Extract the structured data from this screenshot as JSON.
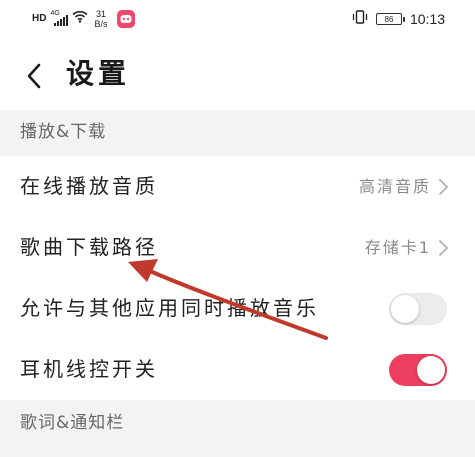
{
  "status_bar": {
    "hd": "HD",
    "network": "4G",
    "speed_value": "31",
    "speed_unit": "B/s",
    "battery": "86",
    "time": "10:13"
  },
  "header": {
    "title": "设置"
  },
  "sections": [
    {
      "title": "播放&下载",
      "rows": [
        {
          "label": "在线播放音质",
          "value": "高清音质"
        },
        {
          "label": "歌曲下载路径",
          "value": "存储卡1"
        },
        {
          "label": "允许与其他应用同时播放音乐",
          "toggle": false
        },
        {
          "label": "耳机线控开关",
          "toggle": true
        }
      ]
    },
    {
      "title": "歌词&通知栏"
    }
  ],
  "colors": {
    "accent": "#ec3f5f",
    "annotation_arrow": "#c0392b",
    "section_bg": "#f3f3f3"
  }
}
